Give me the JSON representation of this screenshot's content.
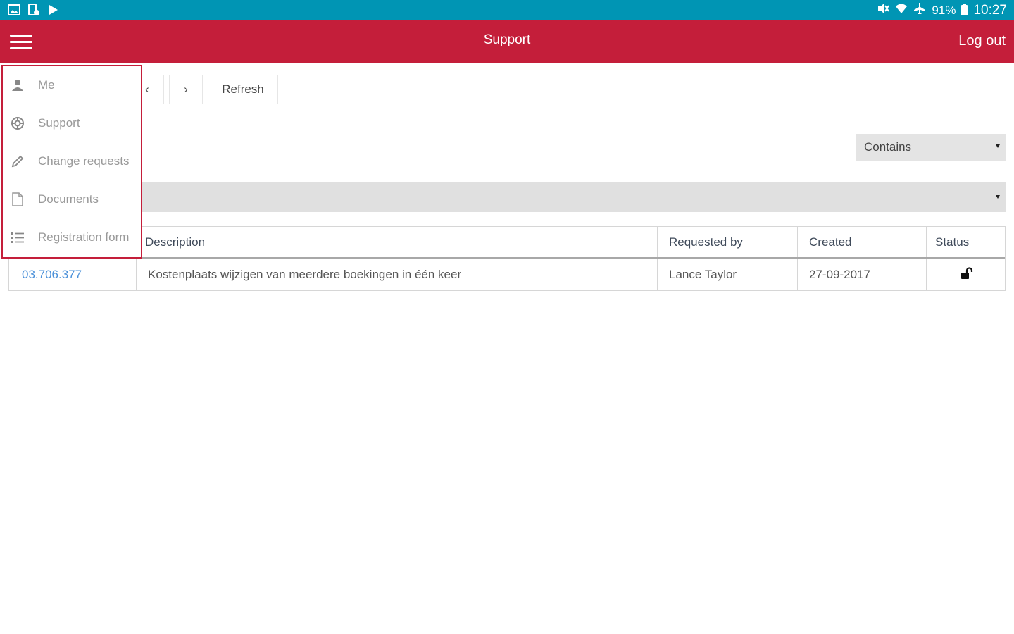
{
  "status_bar": {
    "battery": "91%",
    "time": "10:27",
    "left_icons": [
      "gallery-icon",
      "phone-sync-icon",
      "play-store-icon"
    ],
    "right_icons": [
      "mute-icon",
      "wifi-icon",
      "airplane-icon",
      "battery-icon"
    ]
  },
  "app_bar": {
    "title": "Support",
    "logout_label": "Log out",
    "menu_icon": "hamburger-menu-icon"
  },
  "drawer": {
    "items": [
      {
        "label": "Me",
        "icon": "person-icon"
      },
      {
        "label": "Support",
        "icon": "lifebuoy-icon"
      },
      {
        "label": "Change requests",
        "icon": "pencil-icon"
      },
      {
        "label": "Documents",
        "icon": "document-icon"
      },
      {
        "label": "Registration form",
        "icon": "list-icon"
      }
    ]
  },
  "toolbar": {
    "prev_label": "‹",
    "next_label": "›",
    "refresh_label": "Refresh"
  },
  "search": {
    "value": "",
    "placeholder": "",
    "match_mode": "Contains"
  },
  "filter": {
    "value": ""
  },
  "table": {
    "columns": [
      "Description",
      "Requested by",
      "Created",
      "Status"
    ],
    "rows": [
      {
        "id": "03.706.377",
        "description": "Kostenplaats wijzigen van meerdere boekingen in één keer",
        "requested_by": "Lance Taylor",
        "created": "27-09-2017",
        "status_icon": "unlocked-icon"
      }
    ]
  },
  "colors": {
    "status_bar": "#0095b4",
    "app_bar": "#c41e3a",
    "link": "#4a90d9"
  }
}
